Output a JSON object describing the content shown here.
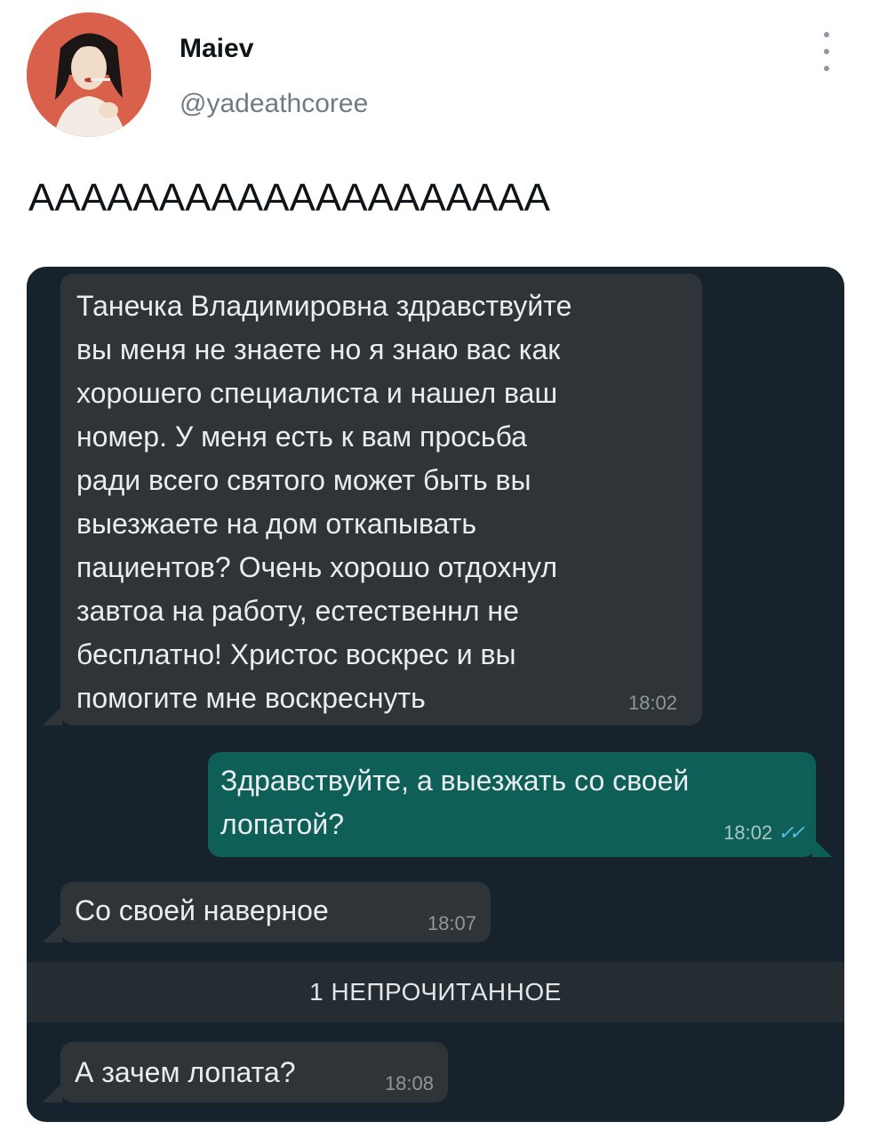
{
  "tweet": {
    "display_name": "Maiev",
    "handle": "@yadeathcoree",
    "text": "АААААААААААААААААААА",
    "avatar_icon": "profile-avatar",
    "menu_icon": "more-vertical-icon"
  },
  "chat": {
    "messages": [
      {
        "direction": "incoming",
        "text": "Танечка Владимировна здравствуйте\nвы меня не знаете но я знаю вас как\nхорошего специалиста и нашел ваш\nномер. У меня есть к вам просьба\nради всего святого может быть вы\nвыезжаете на дом откапывать\nпациентов? Очень хорошо отдохнул\nзавтоа на работу, естественнл не\nбесплатно! Христос воскрес и вы\nпомогите мне воскреснуть",
        "time": "18:02"
      },
      {
        "direction": "outgoing",
        "text": "Здравствуйте, а выезжать со своей\nлопатой?",
        "time": "18:02",
        "status": "read"
      },
      {
        "direction": "incoming",
        "text": "Со своей наверное",
        "time": "18:07"
      },
      {
        "direction": "incoming",
        "text": "А зачем лопата?",
        "time": "18:08"
      }
    ],
    "unread_label": "1 НЕПРОЧИТАННОЕ"
  },
  "colors": {
    "chat_background": "#17232c",
    "incoming_bubble": "#2f3438",
    "outgoing_bubble": "#0d5f57",
    "read_ticks": "#53bdeb",
    "handle_text": "#6e7b86"
  }
}
